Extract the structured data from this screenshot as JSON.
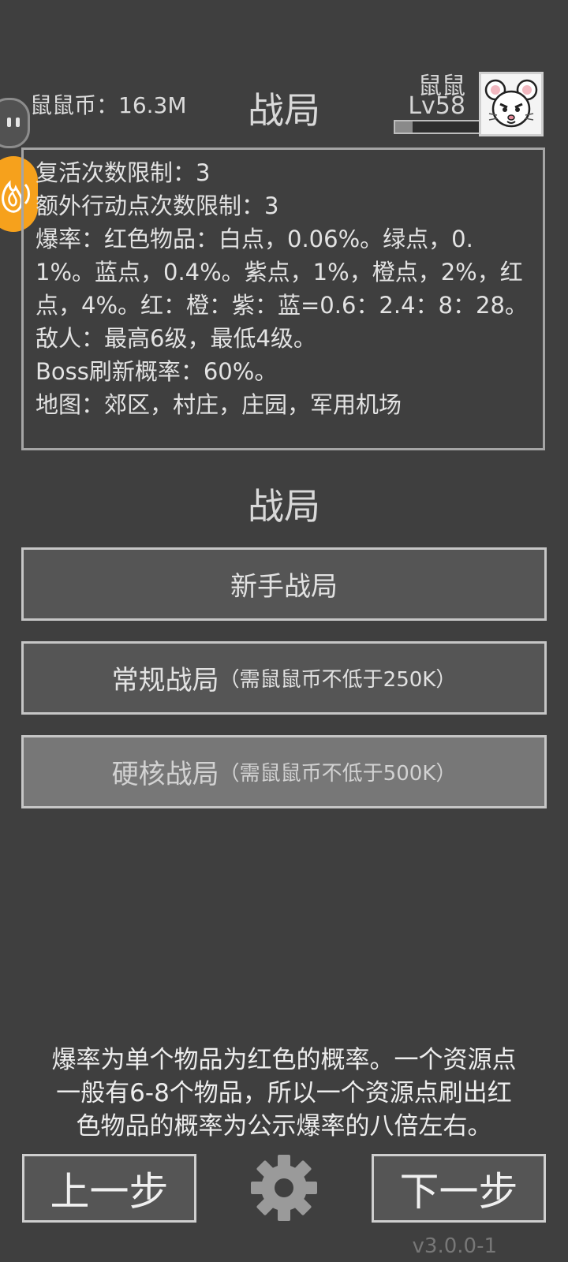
{
  "header": {
    "coins_text": "鼠鼠币：16.3M",
    "title": "战局",
    "player_name": "鼠鼠",
    "player_level": "Lv58",
    "xp_progress": 0.2
  },
  "info_box": {
    "lines": [
      "复活次数限制：3",
      "额外行动点次数限制：3",
      "爆率：红色物品：白点，0.06%。绿点，0.1%。蓝点，0.4%。紫点，1%，橙点，2%，红点，4%。红：橙：紫：蓝=0.6：2.4：8：28。",
      "敌人：最高6级，最低4级。",
      "Boss刷新概率：60%。",
      "地图：郊区，村庄，庄园，军用机场"
    ]
  },
  "section_title": "战局",
  "modes": {
    "novice": {
      "label": "新手战局",
      "note": ""
    },
    "regular": {
      "label": "常规战局",
      "note": "（需鼠鼠币不低于250K）"
    },
    "hardcore": {
      "label": "硬核战局",
      "note": "（需鼠鼠币不低于500K）"
    }
  },
  "tip": [
    "爆率为单个物品为红色的概率。一个资源点",
    "一般有6-8个物品，所以一个资源点刷出红",
    "色物品的概率为公示爆率的八倍左右。"
  ],
  "nav": {
    "prev_label": "上一步",
    "next_label": "下一步"
  },
  "version": "v3.0.0-1",
  "icons": {
    "bot": "robot-face-icon",
    "fire": "fire-emblem-icon",
    "settings": "gear-icon",
    "avatar": "mouse-avatar"
  },
  "colors": {
    "background": "#3f3f3f",
    "button": "#555555",
    "button_disabled": "#777777",
    "accent_orange": "#f6a11c"
  }
}
